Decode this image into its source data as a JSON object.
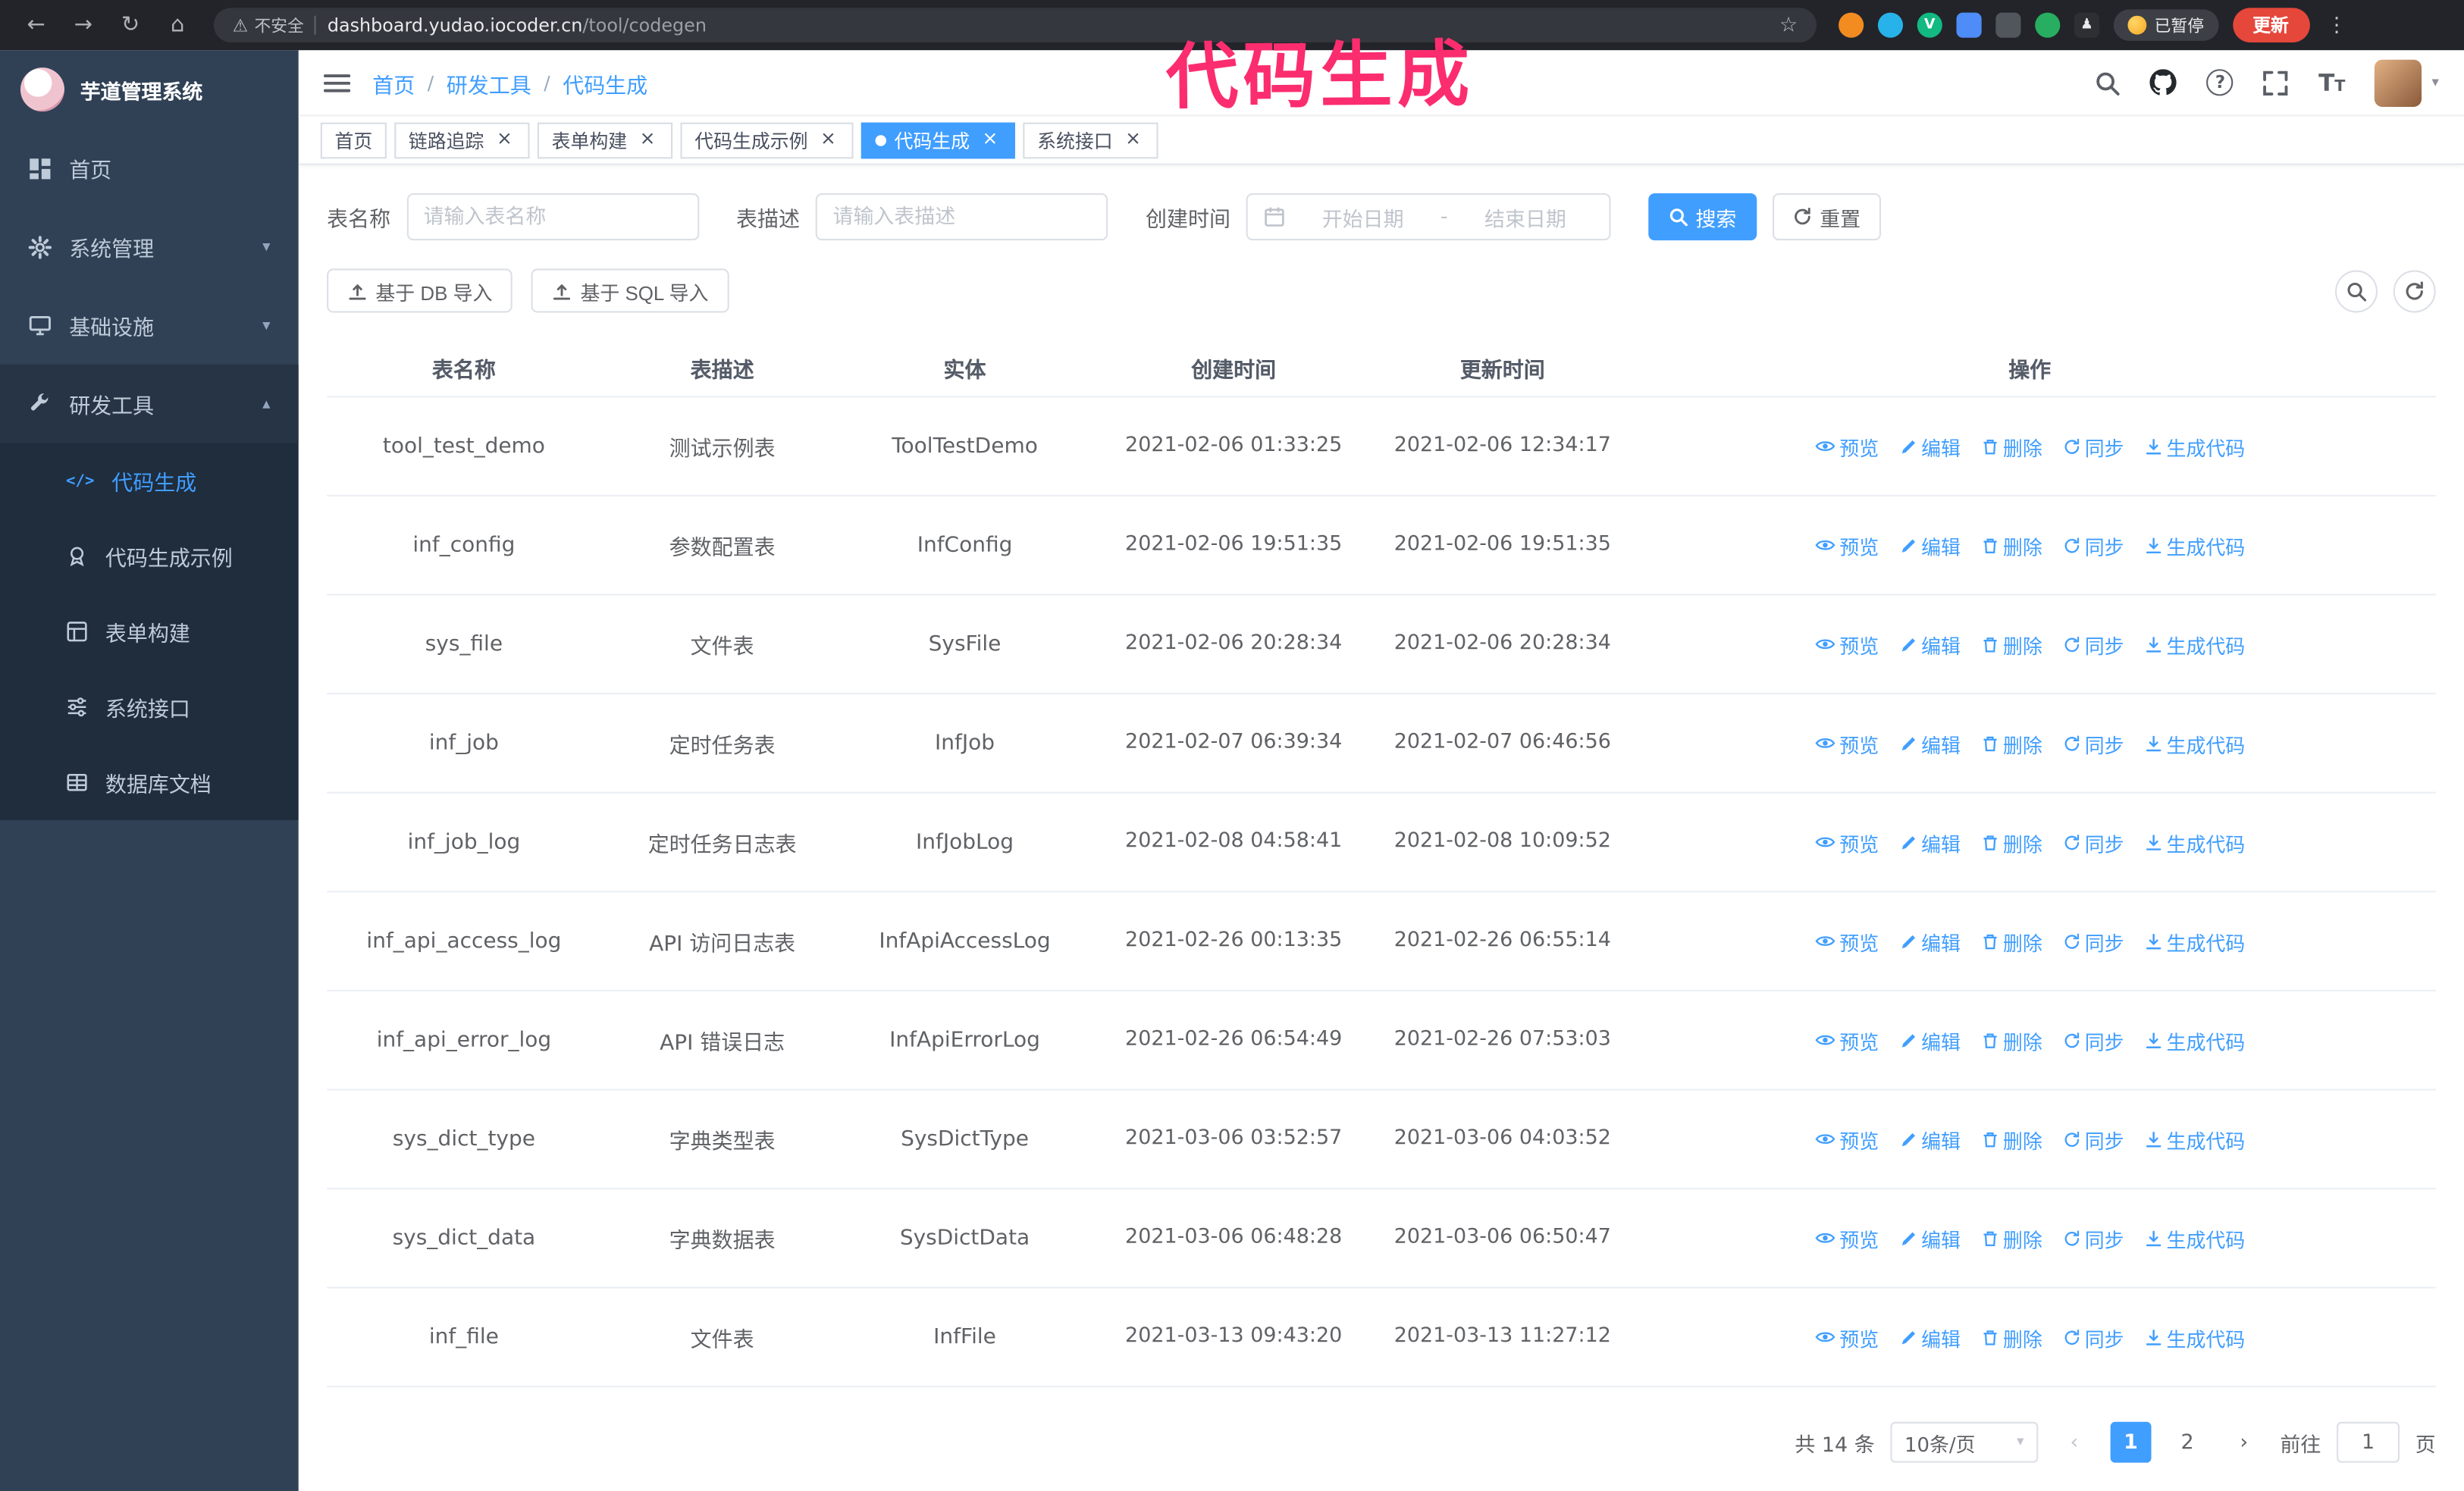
{
  "colors": {
    "primary": "#409EFF",
    "sidebar_bg": "#304156",
    "submenu_bg": "#1F2D3D",
    "annotation_pink": "#FB2D6F",
    "active_tab_bg": "#409EFF",
    "update_button_bg": "#E5473B"
  },
  "annotation": {
    "text": "代码生成"
  },
  "browser": {
    "security_label": "不安全",
    "url_host": "dashboard.yudao.iocoder.cn",
    "url_path": "/tool/codegen",
    "paused_badge": "已暂停",
    "update_label": "更新"
  },
  "sidebar": {
    "app_title": "芋道管理系统",
    "items": [
      {
        "label": "首页"
      },
      {
        "label": "系统管理",
        "expandable": true
      },
      {
        "label": "基础设施",
        "expandable": true
      },
      {
        "label": "研发工具",
        "expandable": true,
        "expanded": true
      }
    ],
    "submenu": [
      {
        "label": "代码生成",
        "active": true
      },
      {
        "label": "代码生成示例"
      },
      {
        "label": "表单构建"
      },
      {
        "label": "系统接口"
      },
      {
        "label": "数据库文档"
      }
    ]
  },
  "header": {
    "breadcrumb": [
      "首页",
      "研发工具",
      "代码生成"
    ],
    "separator": "/"
  },
  "tabs": [
    {
      "label": "首页"
    },
    {
      "label": "链路追踪",
      "closable": true
    },
    {
      "label": "表单构建",
      "closable": true
    },
    {
      "label": "代码生成示例",
      "closable": true
    },
    {
      "label": "代码生成",
      "closable": true,
      "active": true
    },
    {
      "label": "系统接口",
      "closable": true
    }
  ],
  "search_form": {
    "table_name_label": "表名称",
    "table_name_placeholder": "请输入表名称",
    "table_desc_label": "表描述",
    "table_desc_placeholder": "请输入表描述",
    "create_time_label": "创建时间",
    "date_start_placeholder": "开始日期",
    "date_separator": "-",
    "date_end_placeholder": "结束日期",
    "search_button": "搜索",
    "reset_button": "重置"
  },
  "toolbar": {
    "import_db_button": "基于 DB 导入",
    "import_sql_button": "基于 SQL 导入"
  },
  "table": {
    "columns": [
      "表名称",
      "表描述",
      "实体",
      "创建时间",
      "更新时间",
      "操作"
    ],
    "row_actions": [
      "预览",
      "编辑",
      "删除",
      "同步",
      "生成代码"
    ],
    "rows": [
      {
        "name": "tool_test_demo",
        "desc": "测试示例表",
        "entity": "ToolTestDemo",
        "create_time": "2021-02-06 01:33:25",
        "update_time": "2021-02-06 12:34:17"
      },
      {
        "name": "inf_config",
        "desc": "参数配置表",
        "entity": "InfConfig",
        "create_time": "2021-02-06 19:51:35",
        "update_time": "2021-02-06 19:51:35"
      },
      {
        "name": "sys_file",
        "desc": "文件表",
        "entity": "SysFile",
        "create_time": "2021-02-06 20:28:34",
        "update_time": "2021-02-06 20:28:34"
      },
      {
        "name": "inf_job",
        "desc": "定时任务表",
        "entity": "InfJob",
        "create_time": "2021-02-07 06:39:34",
        "update_time": "2021-02-07 06:46:56"
      },
      {
        "name": "inf_job_log",
        "desc": "定时任务日志表",
        "entity": "InfJobLog",
        "create_time": "2021-02-08 04:58:41",
        "update_time": "2021-02-08 10:09:52"
      },
      {
        "name": "inf_api_access_log",
        "desc": "API 访问日志表",
        "entity": "InfApiAccessLog",
        "create_time": "2021-02-26 00:13:35",
        "update_time": "2021-02-26 06:55:14"
      },
      {
        "name": "inf_api_error_log",
        "desc": "API 错误日志",
        "entity": "InfApiErrorLog",
        "create_time": "2021-02-26 06:54:49",
        "update_time": "2021-02-26 07:53:03"
      },
      {
        "name": "sys_dict_type",
        "desc": "字典类型表",
        "entity": "SysDictType",
        "create_time": "2021-03-06 03:52:57",
        "update_time": "2021-03-06 04:03:52"
      },
      {
        "name": "sys_dict_data",
        "desc": "字典数据表",
        "entity": "SysDictData",
        "create_time": "2021-03-06 06:48:28",
        "update_time": "2021-03-06 06:50:47"
      },
      {
        "name": "inf_file",
        "desc": "文件表",
        "entity": "InfFile",
        "create_time": "2021-03-13 09:43:20",
        "update_time": "2021-03-13 11:27:12"
      }
    ]
  },
  "pagination": {
    "total_text": "共 14 条",
    "page_size": "10条/页",
    "prev_icon": "‹",
    "next_icon": "›",
    "pages": [
      "1",
      "2"
    ],
    "goto_label": "前往",
    "goto_value": "1",
    "goto_suffix": "页"
  }
}
